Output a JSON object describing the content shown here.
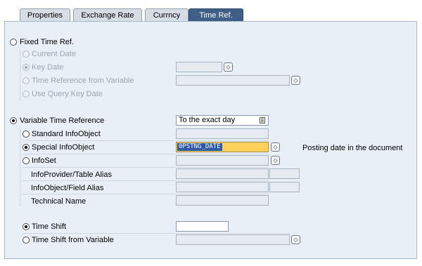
{
  "tabs": [
    {
      "label": "Properties"
    },
    {
      "label": "Exchange Rate"
    },
    {
      "label": "Currncy"
    },
    {
      "label": "Time Ref."
    }
  ],
  "fixed": {
    "title": "Fixed Time Ref.",
    "options": [
      {
        "label": "Current Date"
      },
      {
        "label": "Key Date"
      },
      {
        "label": "Time Reference from Variable"
      },
      {
        "label": "Use Query Key Date"
      }
    ]
  },
  "variable": {
    "title": "Variable Time Reference",
    "dropdown_value": "To the exact day",
    "options": [
      {
        "label": "Standard InfoObject"
      },
      {
        "label": "Special InfoObject",
        "value": "0PSTNG_DATE",
        "description": "Posting date in the document"
      },
      {
        "label": "InfoSet"
      }
    ],
    "infoprovider_alias": "InfoProvider/Table Alias",
    "infoobject_alias": "InfoObject/Field Alias",
    "technical_name": "Technical Name"
  },
  "shift": {
    "time_shift": "Time Shift",
    "time_shift_variable": "Time Shift from Variable"
  },
  "colors": {
    "active_tab": "#3f5f86",
    "panel_bg": "#e8eff6",
    "selected_field": "#ffd05a"
  }
}
